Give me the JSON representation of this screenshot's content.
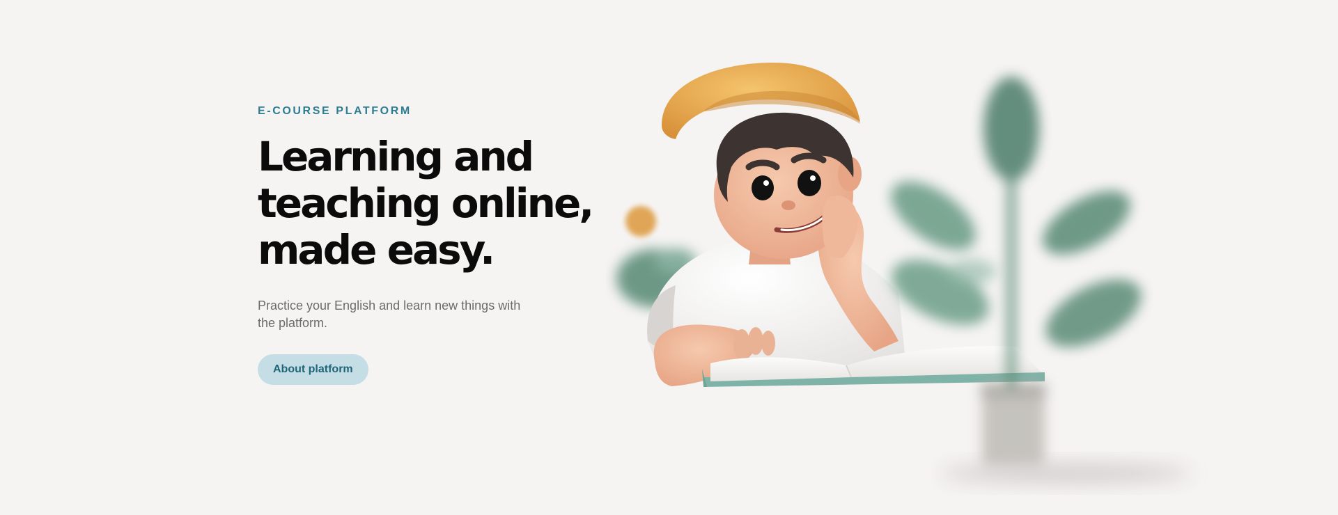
{
  "hero": {
    "eyebrow": "E-COURSE PLATFORM",
    "headline_lines": [
      "Learning and",
      "teaching online,",
      "made easy."
    ],
    "subtext": "Practice your English and learn new things with the platform.",
    "cta_label": "About platform"
  },
  "colors": {
    "background": "#f6f4f3",
    "accent": "#2d7d92",
    "cta_bg": "#c5dee6",
    "cta_text": "#1f6578",
    "cap": "#e9a94b",
    "plant": "#4f7f6c"
  },
  "icons": {
    "illustration": "boy-reading-book-illustration",
    "plant": "plant-icon",
    "ball": "ball-icon"
  }
}
